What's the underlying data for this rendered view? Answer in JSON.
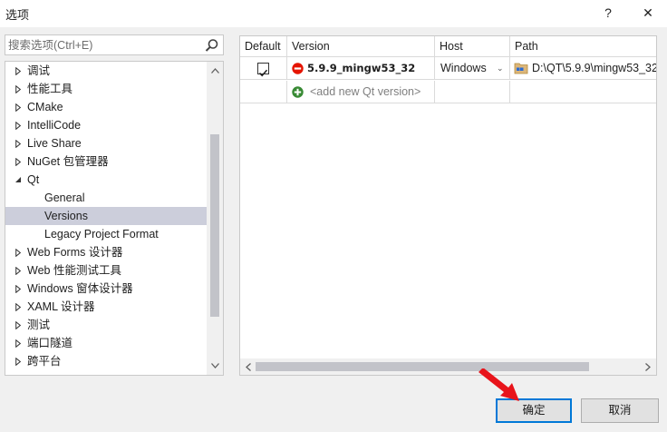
{
  "window": {
    "title": "选项",
    "help_label": "?",
    "close_label": "✕"
  },
  "search": {
    "placeholder": "搜索选项(Ctrl+E)",
    "value": ""
  },
  "tree": {
    "items": [
      {
        "label": "调试",
        "level": 0,
        "expanded": false,
        "selected": false
      },
      {
        "label": "性能工具",
        "level": 0,
        "expanded": false,
        "selected": false
      },
      {
        "label": "CMake",
        "level": 0,
        "expanded": false,
        "selected": false
      },
      {
        "label": "IntelliCode",
        "level": 0,
        "expanded": false,
        "selected": false
      },
      {
        "label": "Live Share",
        "level": 0,
        "expanded": false,
        "selected": false
      },
      {
        "label": "NuGet 包管理器",
        "level": 0,
        "expanded": false,
        "selected": false
      },
      {
        "label": "Qt",
        "level": 0,
        "expanded": true,
        "selected": false
      },
      {
        "label": "General",
        "level": 1,
        "expanded": false,
        "selected": false
      },
      {
        "label": "Versions",
        "level": 1,
        "expanded": false,
        "selected": true
      },
      {
        "label": "Legacy Project Format",
        "level": 1,
        "expanded": false,
        "selected": false
      },
      {
        "label": "Web Forms 设计器",
        "level": 0,
        "expanded": false,
        "selected": false
      },
      {
        "label": "Web 性能测试工具",
        "level": 0,
        "expanded": false,
        "selected": false
      },
      {
        "label": "Windows 窗体设计器",
        "level": 0,
        "expanded": false,
        "selected": false
      },
      {
        "label": "XAML 设计器",
        "level": 0,
        "expanded": false,
        "selected": false
      },
      {
        "label": "测试",
        "level": 0,
        "expanded": false,
        "selected": false
      },
      {
        "label": "端口隧道",
        "level": 0,
        "expanded": false,
        "selected": false
      },
      {
        "label": "跨平台",
        "level": 0,
        "expanded": false,
        "selected": false
      }
    ]
  },
  "grid": {
    "columns": [
      "Default",
      "Version",
      "Host",
      "Path"
    ],
    "rows": [
      {
        "default_checked": true,
        "version": "5.9.9_mingw53_32",
        "host": "Windows",
        "path": "D:\\QT\\5.9.9\\mingw53_32"
      },
      {
        "add_label": "<add new Qt version>"
      }
    ]
  },
  "buttons": {
    "ok": "确定",
    "cancel": "取消"
  },
  "colors": {
    "selection": "#cccedb",
    "focus_border": "#0078d7",
    "annotation_arrow": "#e8141b",
    "error_icon": "#e51400",
    "add_icon": "#388a34"
  }
}
